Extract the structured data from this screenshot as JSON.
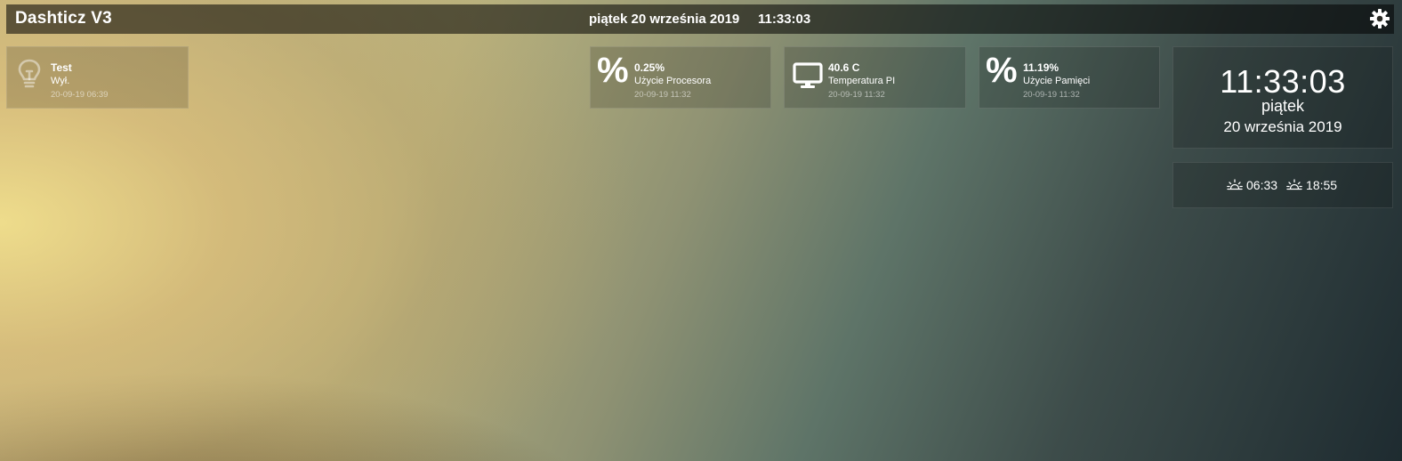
{
  "header": {
    "title": "Dashticz V3",
    "date": "piątek 20 września 2019",
    "time": "11:33:03",
    "settings_icon": "gear-icon"
  },
  "tiles": [
    {
      "icon": "lightbulb-icon",
      "value": "Test",
      "label": "Wył.",
      "timestamp": "20-09-19 06:39"
    },
    {
      "icon": "percent-icon",
      "value": "0.25%",
      "label": "Użycie Procesora",
      "timestamp": "20-09-19 11:32"
    },
    {
      "icon": "monitor-icon",
      "value": "40.6 C",
      "label": "Temperatura PI",
      "timestamp": "20-09-19 11:32"
    },
    {
      "icon": "percent-icon",
      "value": "11.19%",
      "label": "Użycie Pamięci",
      "timestamp": "20-09-19 11:32"
    }
  ],
  "clock": {
    "time": "11:33:03",
    "day": "piątek",
    "date": "20 września 2019"
  },
  "sun": {
    "sunrise": "06:33",
    "sunset": "18:55",
    "sunrise_icon": "sunrise-icon",
    "sunset_icon": "sunset-icon"
  },
  "colors": {
    "topbar": "#1f1f1a",
    "text": "#ffffff"
  }
}
